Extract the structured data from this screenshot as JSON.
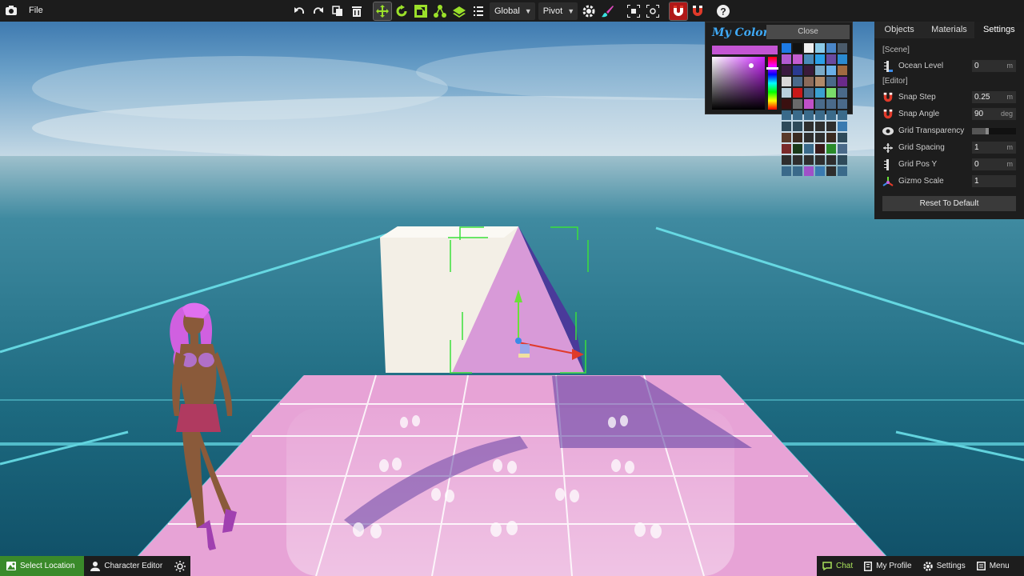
{
  "toolbar": {
    "file_label": "File",
    "space_mode": "Global",
    "pivot_mode": "Pivot",
    "accent_color": "#9be02a",
    "snap_color": "#b01818"
  },
  "color_picker": {
    "title": "My Colors",
    "close_label": "Close",
    "current_color": "#c455d3",
    "swatches": [
      "#1d7be6",
      "#111111",
      "#f0f0f0",
      "#8ccbe8",
      "#4a86c8",
      "#4a5a6a",
      "#b05bd0",
      "#c45ccf",
      "#4a8ab8",
      "#2aa0e8",
      "#6a4aa0",
      "#2a8ad0",
      "#3a1a40",
      "#2a3a90",
      "#3a1a3a",
      "#7aaac8",
      "#6ab0e8",
      "#a06a40",
      "#d8d8d8",
      "#4a6a8a",
      "#8a6a5a",
      "#b08a6a",
      "#4a6a8a",
      "#6a2a8a",
      "#b8d0dc",
      "#c81818",
      "#4a6a8a",
      "#3aa0d0",
      "#7adc6a",
      "#4a6a8a",
      "#3a1010",
      "#6a6a6a",
      "#c050c8",
      "#4a6a8a",
      "#4a6a8a",
      "#4a6a8a",
      "#3a6a8a",
      "#3a6a8a",
      "#3a6a8a",
      "#3a6a8a",
      "#3a6a8a",
      "#3a6a8a",
      "#2e4a5a",
      "#2e4a5a",
      "#2e2e2e",
      "#2e2e2e",
      "#2e2e2e",
      "#3a7ab0",
      "#5a3a2a",
      "#3a2a20",
      "#2e2e2e",
      "#2e2e2e",
      "#3a2a20",
      "#2e4a5a",
      "#7a2a2a",
      "#1a3a1a",
      "#3a6a8a",
      "#3a1a1a",
      "#2a8a2a",
      "#4a6a8a",
      "#2e2e2e",
      "#2e2e2e",
      "#2e2e2e",
      "#2e2e2e",
      "#2e2e2e",
      "#2e4a5a",
      "#3a6a8a",
      "#3a6a8a",
      "#a050c8",
      "#3a7ab0",
      "#2e2e2e",
      "#3a6a8a"
    ]
  },
  "panel": {
    "tabs": [
      {
        "label": "Objects",
        "active": false
      },
      {
        "label": "Materials",
        "active": false
      },
      {
        "label": "Settings",
        "active": true
      }
    ],
    "scene_header": "[Scene]",
    "editor_header": "[Editor]",
    "ocean_level": {
      "label": "Ocean Level",
      "value": "0",
      "unit": "m"
    },
    "snap_step": {
      "label": "Snap Step",
      "value": "0.25",
      "unit": "m"
    },
    "snap_angle": {
      "label": "Snap Angle",
      "value": "90",
      "unit": "deg"
    },
    "grid_transparency": {
      "label": "Grid Transparency",
      "value": 0.35
    },
    "grid_spacing": {
      "label": "Grid Spacing",
      "value": "1",
      "unit": "m"
    },
    "grid_pos_y": {
      "label": "Grid Pos Y",
      "value": "0",
      "unit": "m"
    },
    "gizmo_scale": {
      "label": "Gizmo Scale",
      "value": "1"
    },
    "reset_label": "Reset To Default"
  },
  "bottom_bar": {
    "select_location": "Select Location",
    "character_editor": "Character Editor",
    "chat": "Chat",
    "my_profile": "My Profile",
    "settings": "Settings",
    "menu": "Menu"
  },
  "scene": {
    "floor_color": "#e7a3d6",
    "grid_line_color": "#6fe8f0",
    "cube_color": "#f3efe6",
    "ramp_color": "#d89ad8",
    "ramp_side_color": "#4a3a9a",
    "character_hair_color": "#d060e0"
  }
}
